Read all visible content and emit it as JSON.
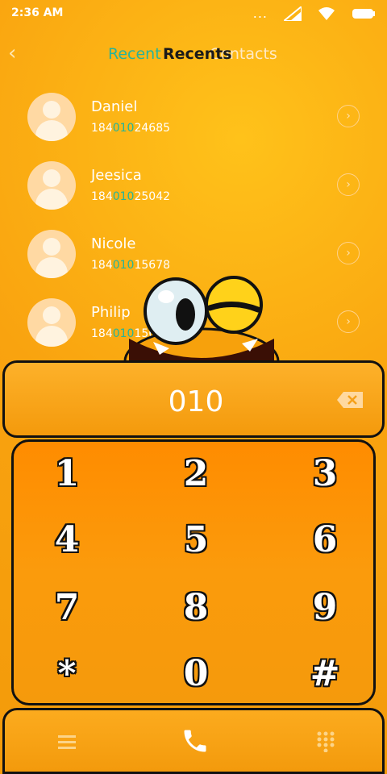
{
  "status_bar": {
    "time": "2:36 AM",
    "overflow": "..."
  },
  "header": {
    "tabs": [
      {
        "label": "Recent"
      },
      {
        "label": "Recents"
      },
      {
        "label": "Contacts"
      }
    ]
  },
  "contacts": [
    {
      "name": "Daniel",
      "number_prefix": "184",
      "number_match": "010",
      "number_suffix": "24685"
    },
    {
      "name": "Jeesica",
      "number_prefix": "184",
      "number_match": "010",
      "number_suffix": "25042"
    },
    {
      "name": "Nicole",
      "number_prefix": "184",
      "number_match": "010",
      "number_suffix": "15678"
    },
    {
      "name": "Philip",
      "number_prefix": "184",
      "number_match": "010",
      "number_suffix": "15689"
    }
  ],
  "dialer": {
    "entered": "010",
    "keys": [
      "1",
      "2",
      "3",
      "4",
      "5",
      "6",
      "7",
      "8",
      "9",
      "*",
      "0",
      "#"
    ]
  },
  "colors": {
    "highlight": "#25b59a",
    "background": "#f9a30f"
  },
  "icons": [
    "back-icon",
    "chevron-right-icon",
    "backspace-icon",
    "menu-icon",
    "phone-icon",
    "dialpad-icon"
  ]
}
